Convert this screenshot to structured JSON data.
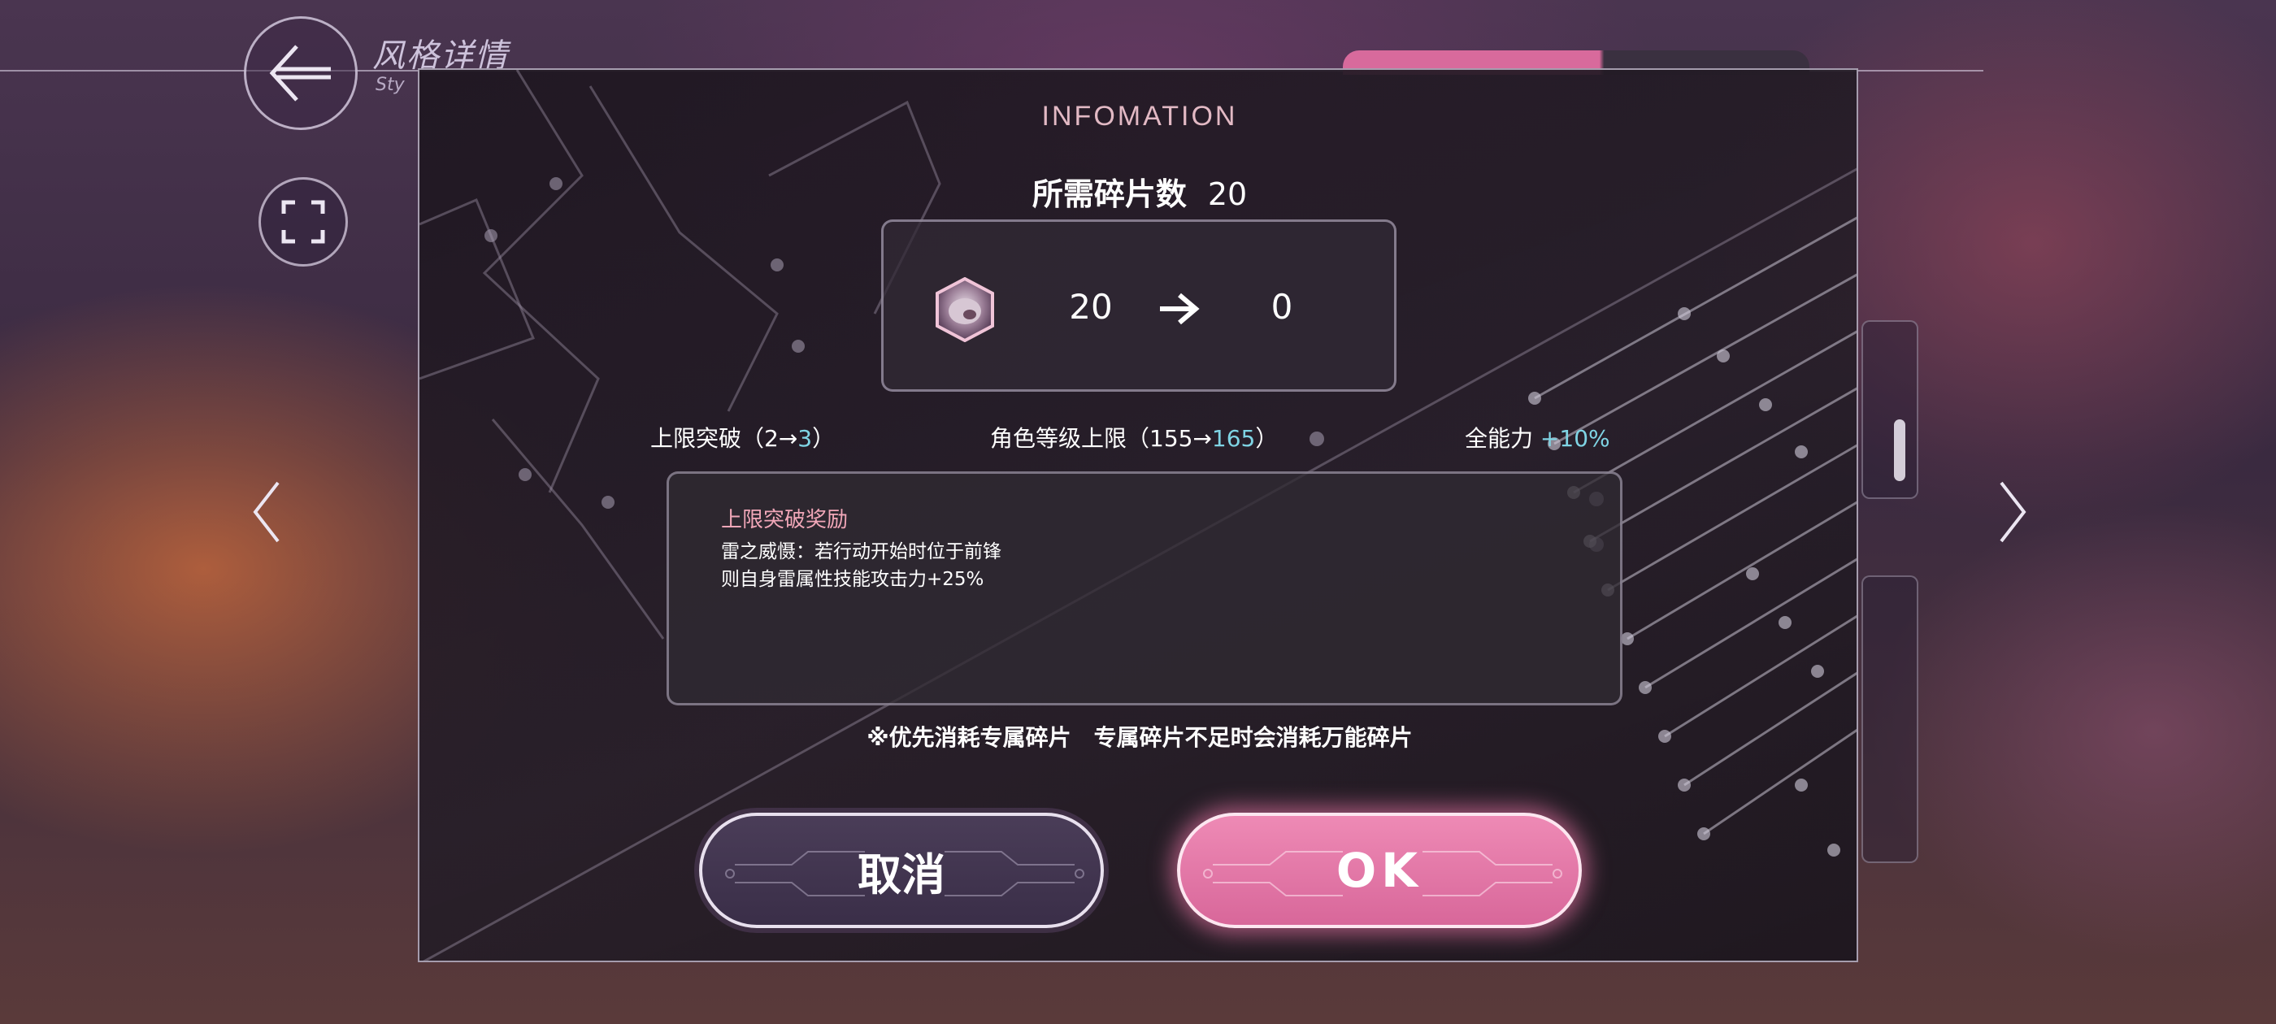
{
  "header": {
    "title": "风格详情",
    "subtitle": "Sty"
  },
  "dialog": {
    "title": "INFOMATION",
    "required_label": "所需碎片数",
    "required_count": "20",
    "shard_from": "20",
    "shard_to": "0",
    "stats": {
      "limit_break_label": "上限突破（2→",
      "limit_break_value": "3",
      "limit_break_close": "）",
      "level_cap_label": "角色等级上限（155→",
      "level_cap_value": "165",
      "level_cap_close": "）",
      "all_ability_label": "全能力",
      "all_ability_value": "+10%"
    },
    "reward": {
      "title": "上限突破奖励",
      "line1": "雷之威慑：若行动开始时位于前锋",
      "line2": "则自身雷属性技能攻击力+25%"
    },
    "note": "※优先消耗专属碎片　专属碎片不足时会消耗万能碎片",
    "cancel_label": "取消",
    "ok_label": "OK"
  },
  "colors": {
    "accent_pink": "#d8679a",
    "highlight_cyan": "#7fd4e4",
    "title_pink": "#e2b9c4",
    "reward_title": "#f1a7b8"
  },
  "icons": [
    "back-arrow-icon",
    "fullscreen-icon",
    "shard-icon",
    "right-arrow-icon",
    "chevron-left-icon",
    "chevron-right-icon"
  ]
}
